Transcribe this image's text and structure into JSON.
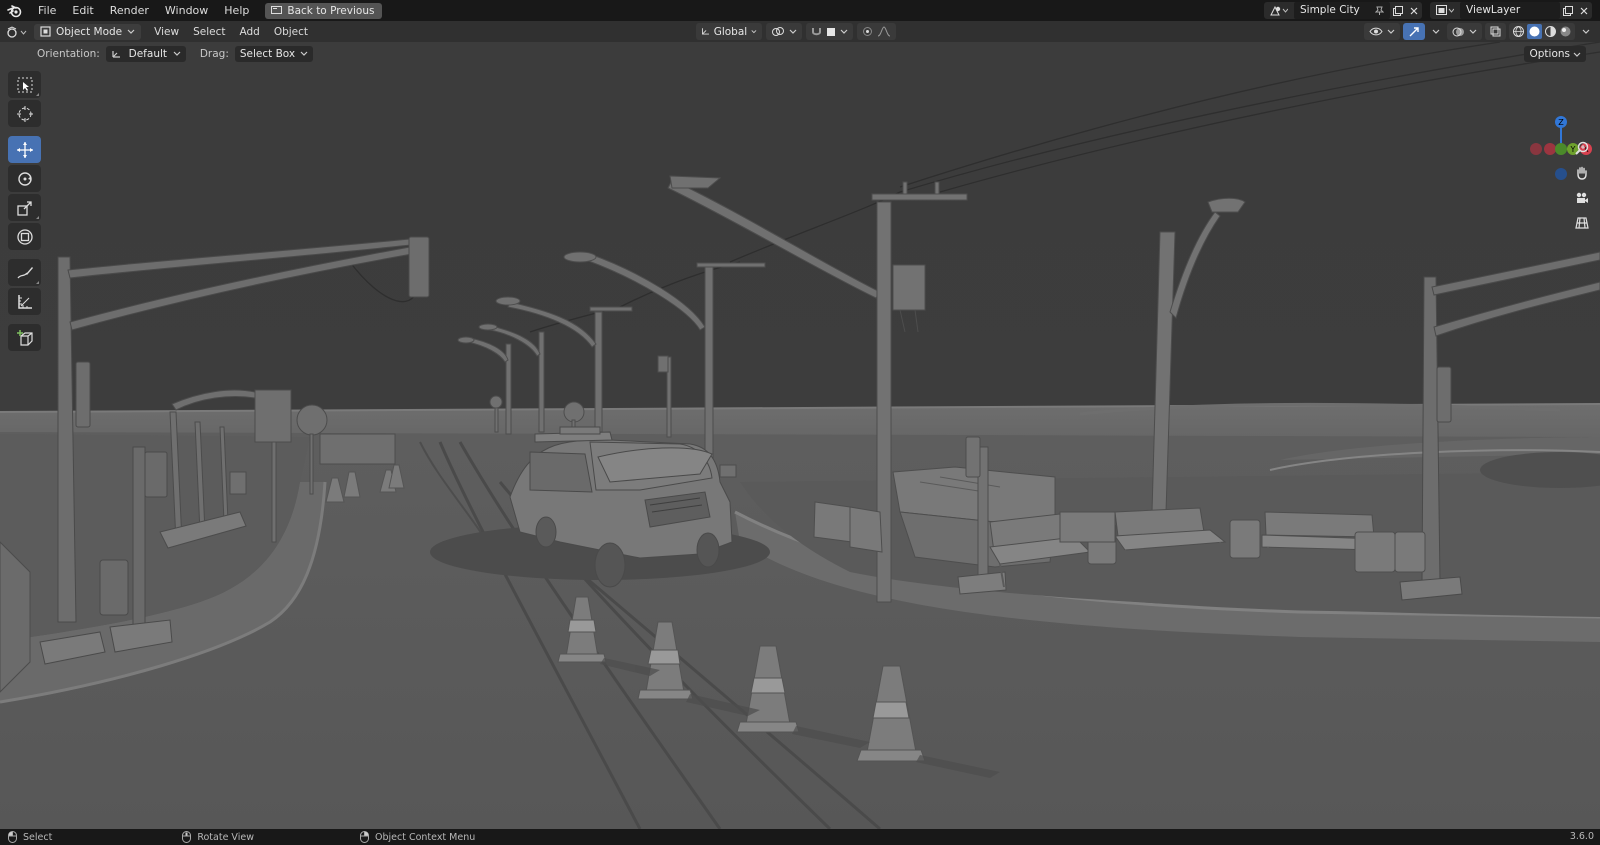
{
  "menubar": {
    "items": [
      "File",
      "Edit",
      "Render",
      "Window",
      "Help"
    ],
    "back_button": "Back to Previous",
    "scene_name": "Simple City",
    "view_layer": "ViewLayer"
  },
  "header": {
    "mode": "Object Mode",
    "menus": [
      "View",
      "Select",
      "Add",
      "Object"
    ],
    "transform_orientation": "Global"
  },
  "tool_settings": {
    "orientation_label": "Orientation:",
    "orientation_value": "Default",
    "drag_label": "Drag:",
    "drag_value": "Select Box",
    "options_label": "Options"
  },
  "gizmo": {
    "z": "Z",
    "y": "Y",
    "x": "X"
  },
  "colors": {
    "accent": "#4772b3",
    "axis_x": "#d8414f",
    "axis_y": "#6ea12d",
    "axis_z": "#3177d8",
    "viewport_bg": "#3d3d3d"
  },
  "statusbar": {
    "select": "Select",
    "rotate_view": "Rotate View",
    "context_menu": "Object Context Menu",
    "version": "3.6.0"
  }
}
